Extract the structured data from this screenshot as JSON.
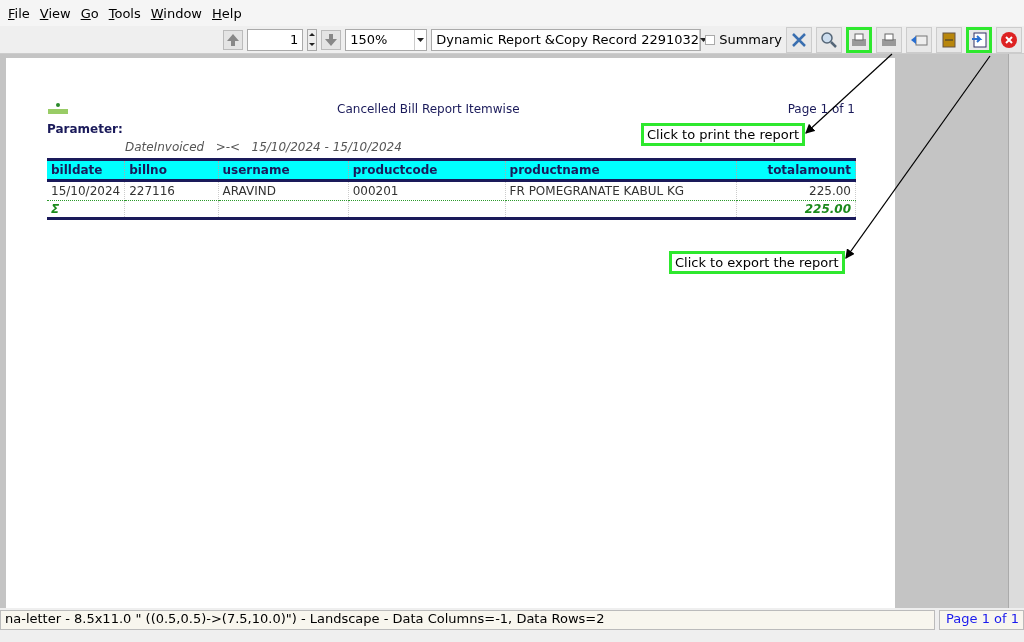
{
  "menu": [
    "File",
    "View",
    "Go",
    "Tools",
    "Window",
    "Help"
  ],
  "toolbar": {
    "page_field": "1",
    "zoom": "150%",
    "report": "Dynamic Report &Copy Record 2291032",
    "summary": {
      "label": "Summary",
      "checked": false
    },
    "tools": [
      {
        "kind": "tools",
        "highlighted": false
      },
      {
        "kind": "search",
        "highlighted": false
      },
      {
        "kind": "print",
        "highlighted": true
      },
      {
        "kind": "printer",
        "highlighted": false
      },
      {
        "kind": "send",
        "highlighted": false
      },
      {
        "kind": "archive",
        "highlighted": false
      },
      {
        "kind": "export",
        "highlighted": true
      },
      {
        "kind": "close",
        "highlighted": false
      }
    ]
  },
  "report": {
    "title": "Cancelled Bill Report Itemwise",
    "page": "Page 1 of 1",
    "parameter_label": "Parameter:",
    "parameter": "DateInvoiced   >-<   15/10/2024 - 15/10/2024",
    "columns": [
      "billdate",
      "billno",
      "username",
      "productcode",
      "productname",
      "totalamount"
    ],
    "rows": [
      [
        "15/10/2024",
        "227116",
        "ARAVIND",
        "000201",
        "FR POMEGRANATE KABUL KG",
        "225.00"
      ]
    ],
    "total": {
      "label": "Σ",
      "amount": "225.00"
    }
  },
  "callouts": [
    "Click to print the report",
    "Click to export the report"
  ],
  "status_bar": {
    "text": "na-letter - 8.5x11.0 \" ((0.5,0.5)->(7.5,10.0)\") - Landscape - Data Columns=-1, Data Rows=2",
    "page": "Page 1 of 1"
  }
}
